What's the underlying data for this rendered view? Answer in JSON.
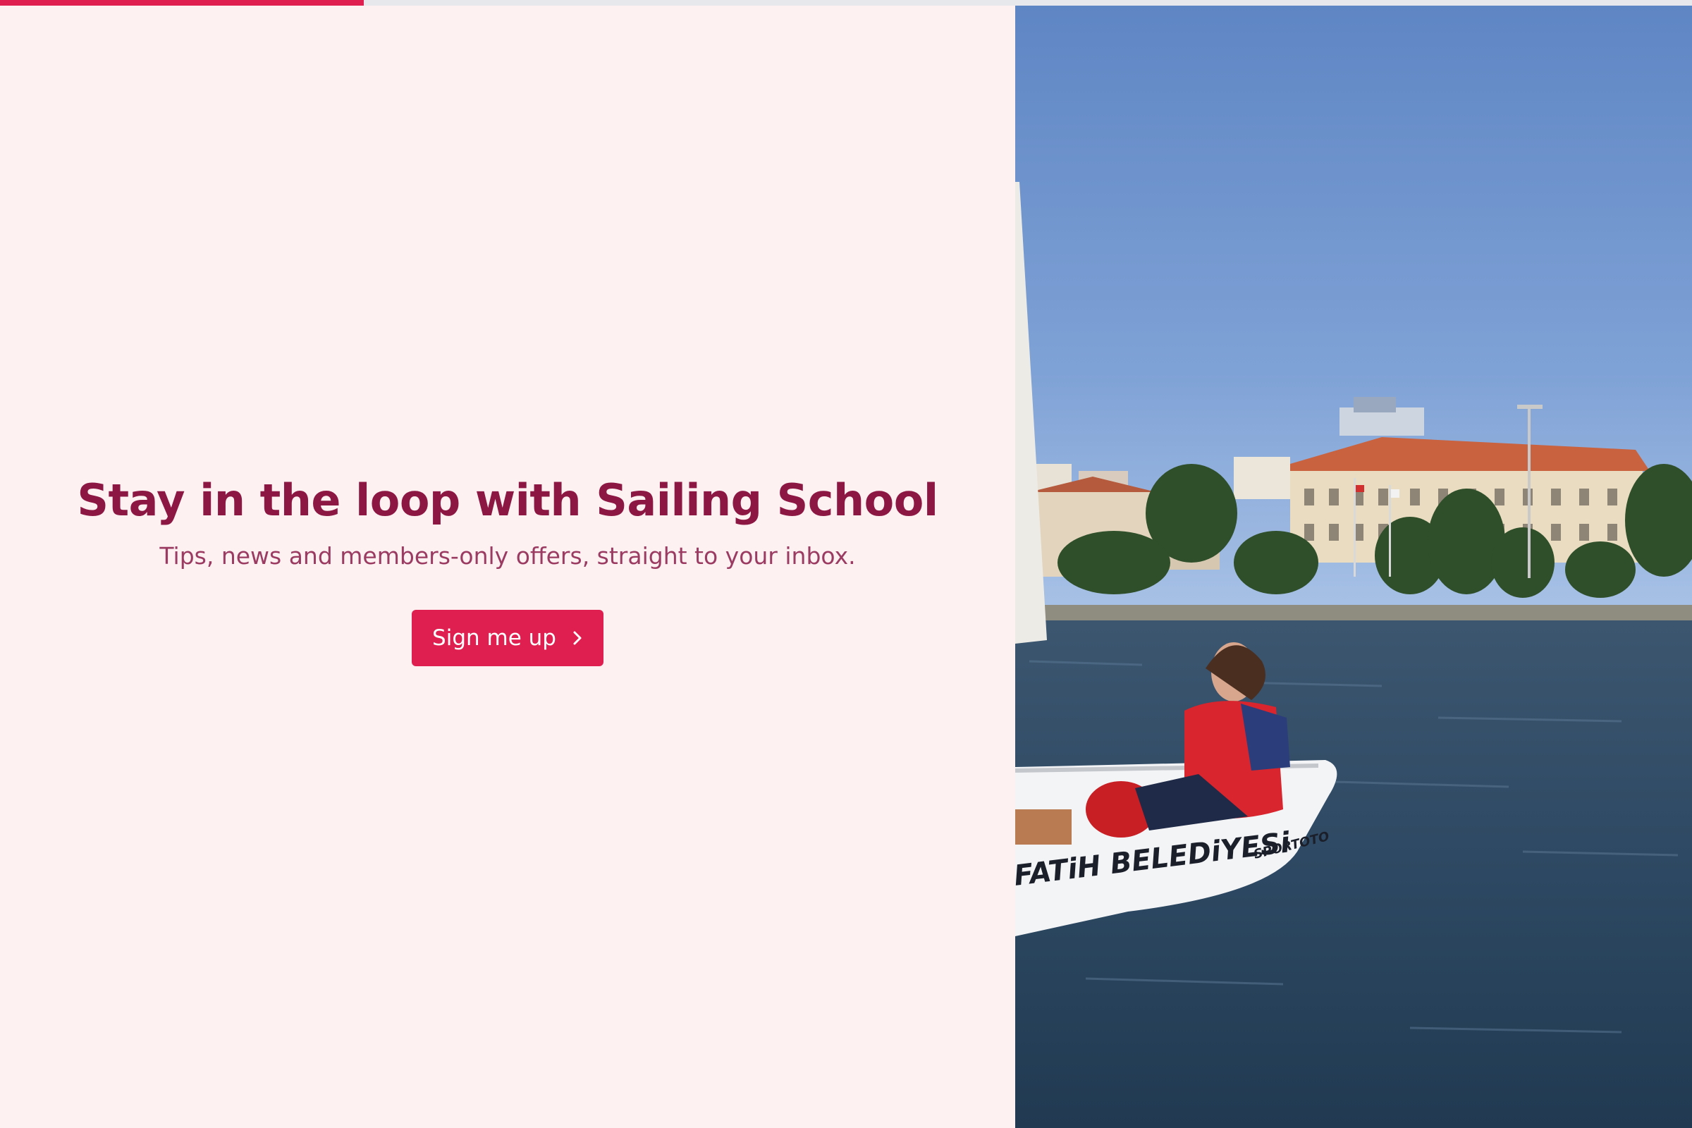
{
  "progress": {
    "fraction": 0.215,
    "fill_color": "#df1f4f",
    "track_color": "#e6e8ec"
  },
  "signup": {
    "headline": "Stay in the loop with Sailing School",
    "subline": "Tips, news and members-only offers, straight to your inbox.",
    "button_label": "Sign me up",
    "button_icon": "chevron-right-icon"
  },
  "colors": {
    "accent": "#df1f4f",
    "headline": "#8c1742",
    "panel_background": "#fdf1f2"
  },
  "photo": {
    "hull_text": "FATiH BELEDiYESi",
    "hull_sponsor": "SPORTOTO"
  }
}
